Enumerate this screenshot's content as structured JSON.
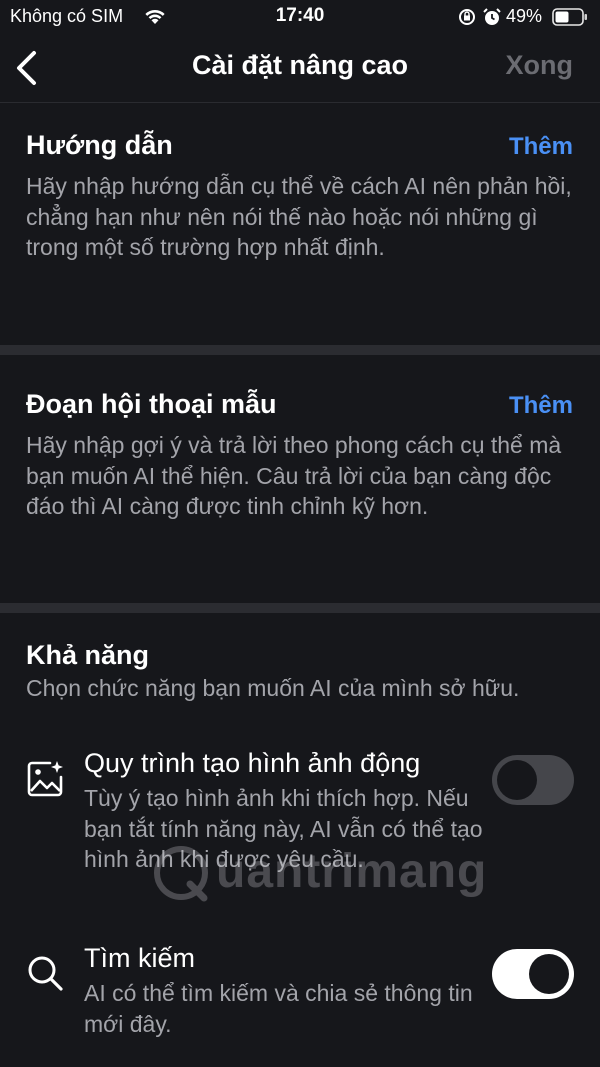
{
  "status_bar": {
    "carrier": "Không có SIM",
    "time": "17:40",
    "battery": "49%"
  },
  "nav": {
    "title": "Cài đặt nâng cao",
    "done_label": "Xong"
  },
  "instructions": {
    "title": "Hướng dẫn",
    "add_label": "Thêm",
    "description": "Hãy nhập hướng dẫn cụ thể về cách AI nên phản hồi, chẳng hạn như nên nói thế nào hoặc nói những gì trong một số trường hợp nhất định."
  },
  "sample_dialog": {
    "title": "Đoạn hội thoại mẫu",
    "add_label": "Thêm",
    "description": "Hãy nhập gợi ý và trả lời theo phong cách cụ thể mà bạn muốn AI thể hiện. Câu trả lời của bạn càng độc đáo thì AI càng được tinh chỉnh kỹ hơn."
  },
  "capabilities": {
    "title": "Khả năng",
    "description": "Chọn chức năng bạn muốn AI của mình sở hữu.",
    "items": [
      {
        "title": "Quy trình tạo hình ảnh động",
        "description": "Tùy ý tạo hình ảnh khi thích hợp. Nếu bạn tắt tính năng này, AI vẫn có thể tạo hình ảnh khi được yêu cầu.",
        "icon": "image-sparkle-icon",
        "enabled": false
      },
      {
        "title": "Tìm kiếm",
        "description": "AI có thể tìm kiếm và chia sẻ thông tin mới đây.",
        "icon": "search-icon",
        "enabled": true
      }
    ]
  },
  "watermark": {
    "text": "uantrimang"
  },
  "colors": {
    "background": "#16171b",
    "accent": "#4a90f5",
    "secondary_text": "#a3a4aa",
    "divider": "#2b2c31"
  }
}
